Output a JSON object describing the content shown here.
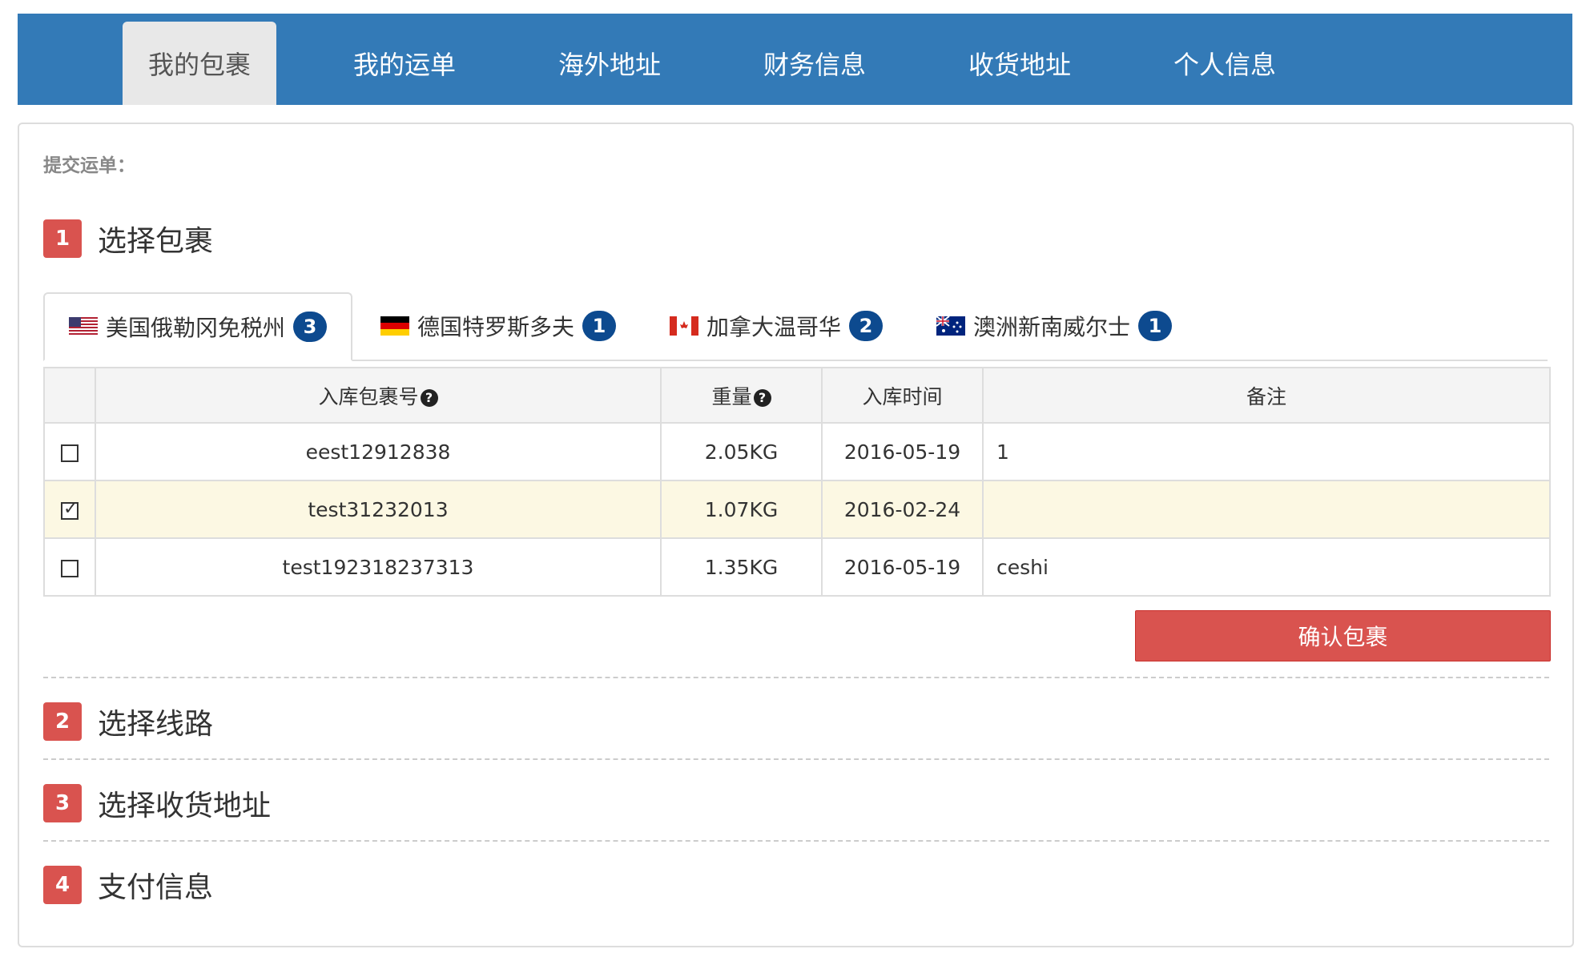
{
  "nav": {
    "items": [
      {
        "label": "我的包裹",
        "active": true
      },
      {
        "label": "我的运单"
      },
      {
        "label": "海外地址"
      },
      {
        "label": "财务信息"
      },
      {
        "label": "收货地址"
      },
      {
        "label": "个人信息"
      }
    ]
  },
  "panel": {
    "submit_label": "提交运单："
  },
  "steps": [
    {
      "num": "1",
      "title": "选择包裹"
    },
    {
      "num": "2",
      "title": "选择线路"
    },
    {
      "num": "3",
      "title": "选择收货地址"
    },
    {
      "num": "4",
      "title": "支付信息"
    }
  ],
  "tabs": [
    {
      "flag": "us-flag-icon",
      "label": "美国俄勒冈免税州",
      "count": "3",
      "active": true
    },
    {
      "flag": "de-flag-icon",
      "label": "德国特罗斯多夫",
      "count": "1"
    },
    {
      "flag": "ca-flag-icon",
      "label": "加拿大温哥华",
      "count": "2"
    },
    {
      "flag": "au-flag-icon",
      "label": "澳洲新南威尔士",
      "count": "1"
    }
  ],
  "table": {
    "headers": {
      "package_no": "入库包裹号",
      "weight": "重量",
      "time": "入库时间",
      "remark": "备注"
    },
    "rows": [
      {
        "checked": false,
        "package_no": "eest12912838",
        "weight": "2.05KG",
        "time": "2016-05-19",
        "remark": "1"
      },
      {
        "checked": true,
        "package_no": "test31232013",
        "weight": "1.07KG",
        "time": "2016-02-24",
        "remark": ""
      },
      {
        "checked": false,
        "package_no": "test192318237313",
        "weight": "1.35KG",
        "time": "2016-05-19",
        "remark": "ceshi"
      }
    ]
  },
  "confirm_button": "确认包裹",
  "colors": {
    "nav_bg": "#337ab7",
    "step_badge": "#d9534f",
    "count_badge": "#0d4a8f",
    "selected_row": "#fcf8e3",
    "confirm_bg": "#d9534f"
  }
}
